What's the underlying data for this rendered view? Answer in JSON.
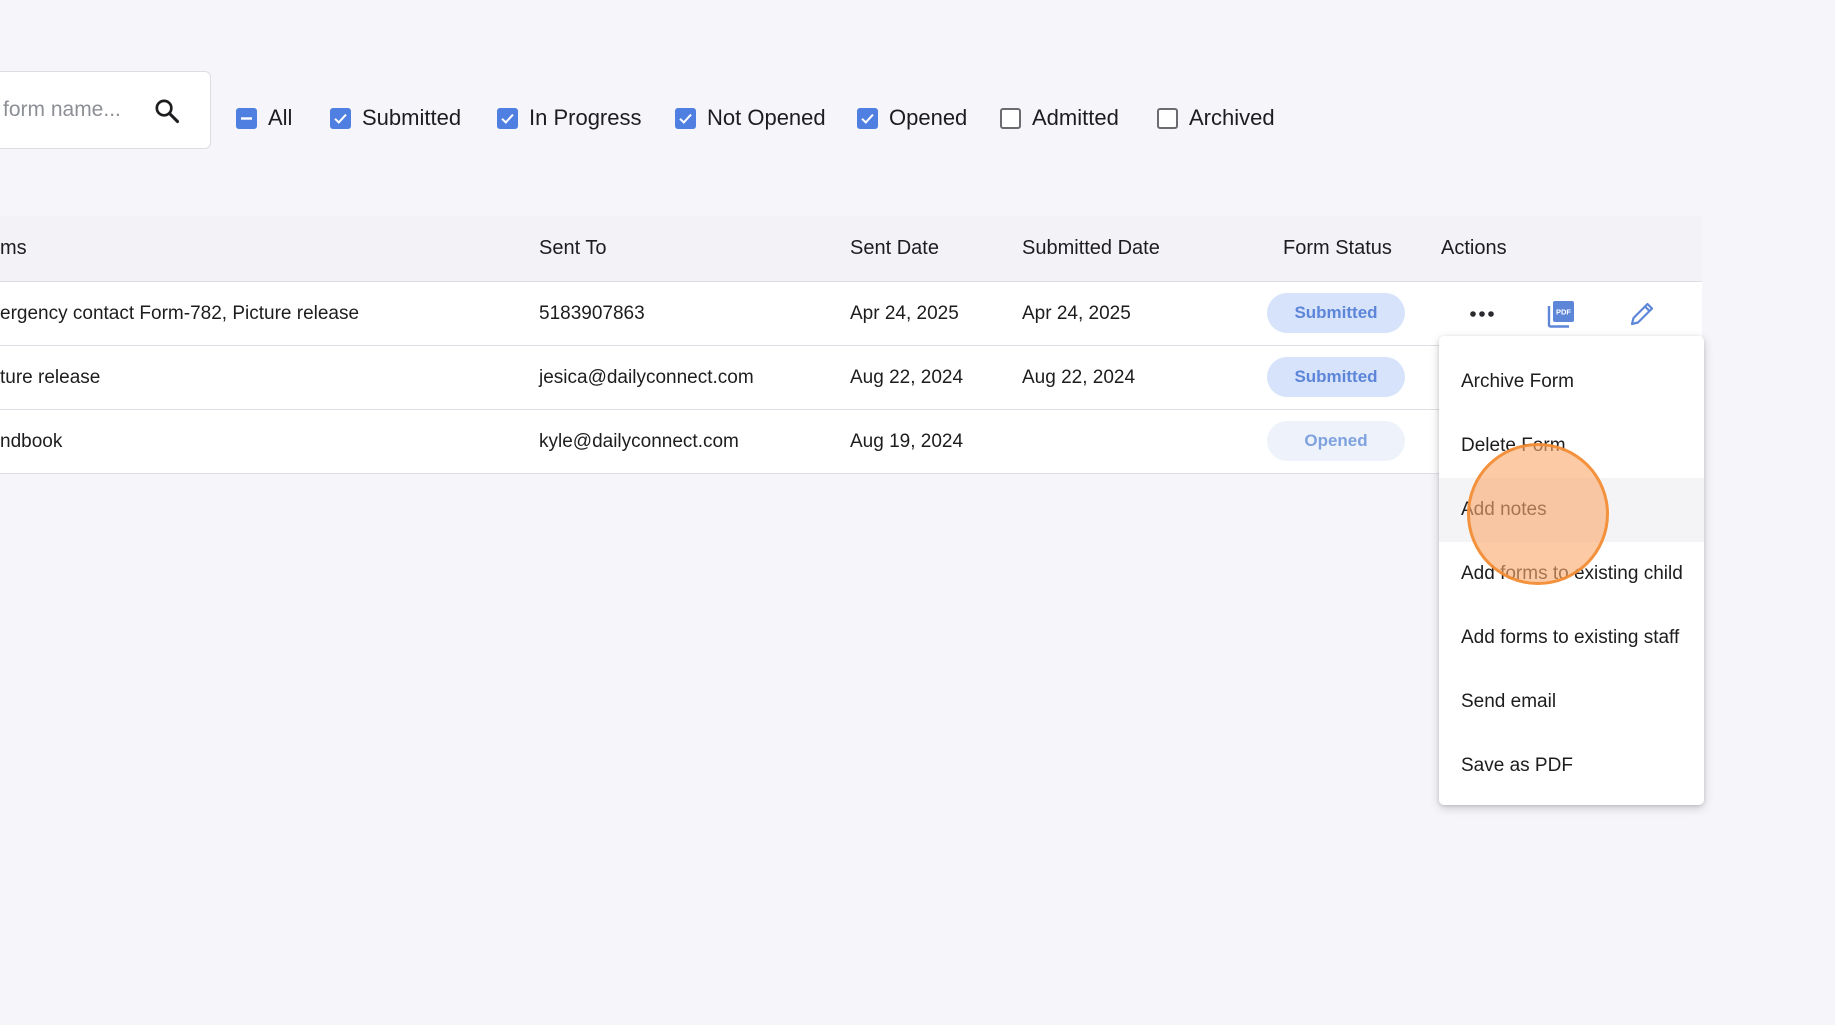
{
  "search": {
    "placeholder": "form name..."
  },
  "filters": [
    {
      "label": "All",
      "state": "indeterminate"
    },
    {
      "label": "Submitted",
      "state": "checked"
    },
    {
      "label": "In Progress",
      "state": "checked"
    },
    {
      "label": "Not Opened",
      "state": "checked"
    },
    {
      "label": "Opened",
      "state": "checked"
    },
    {
      "label": "Admitted",
      "state": "unchecked"
    },
    {
      "label": "Archived",
      "state": "unchecked"
    }
  ],
  "table": {
    "headers": {
      "forms": "ms",
      "sent_to": "Sent To",
      "sent_date": "Sent Date",
      "submitted_date": "Submitted Date",
      "form_status": "Form Status",
      "actions": "Actions"
    },
    "rows": [
      {
        "forms": "ergency contact Form-782, Picture release",
        "sent_to": "5183907863",
        "sent_date": "Apr 24, 2025",
        "submitted_date": "Apr 24, 2025",
        "status": "Submitted"
      },
      {
        "forms": "ture release",
        "sent_to": "jesica@dailyconnect.com",
        "sent_date": "Aug 22, 2024",
        "submitted_date": "Aug 22, 2024",
        "status": "Submitted"
      },
      {
        "forms": "ndbook",
        "sent_to": "kyle@dailyconnect.com",
        "sent_date": "Aug 19, 2024",
        "submitted_date": "",
        "status": "Opened"
      }
    ],
    "action_icons": [
      "more-horizontal-icon",
      "pdf-icon",
      "edit-pencil-icon"
    ]
  },
  "actions_menu": {
    "items": [
      "Archive Form",
      "Delete Form",
      "Add notes",
      "Add forms to existing child",
      "Add forms to existing staff",
      "Send email",
      "Save as PDF"
    ]
  },
  "colors": {
    "accent": "#4f7fe0",
    "badge_submitted_bg": "#d6e3fb",
    "badge_submitted_text": "#5d86d9",
    "badge_opened_bg": "#eef3fb",
    "badge_opened_text": "#7fa1df",
    "click_marker": "#f38c32"
  }
}
